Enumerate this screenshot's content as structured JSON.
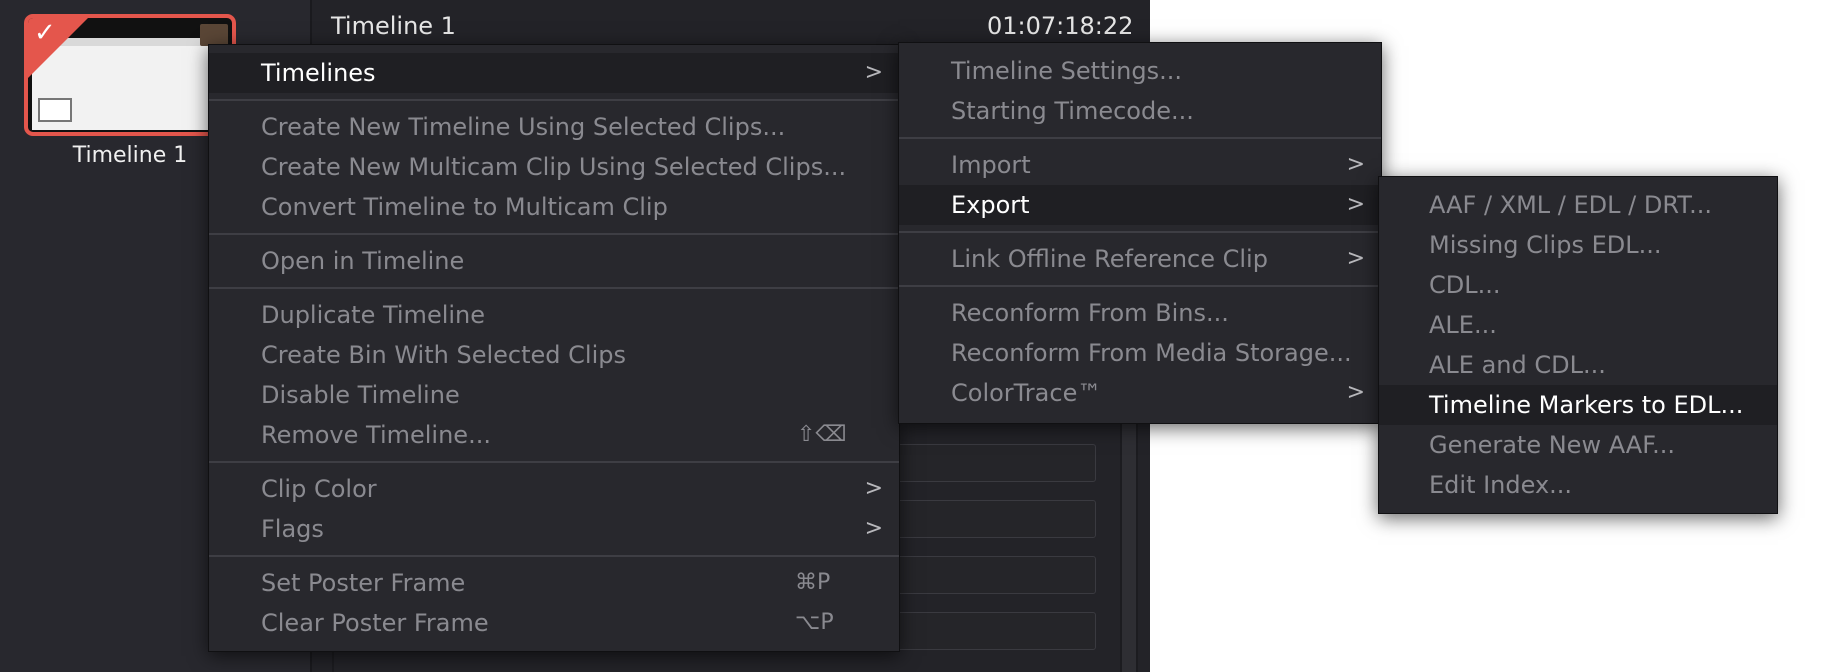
{
  "thumbnail": {
    "label": "Timeline 1",
    "selected": true
  },
  "inspector": {
    "title": "Timeline 1",
    "timecode": "01:07:18:22"
  },
  "context_menu": {
    "items": [
      {
        "label": "Timelines",
        "submenu": true,
        "highlighted": true
      },
      {
        "label": "Create New Timeline Using Selected Clips..."
      },
      {
        "label": "Create New Multicam Clip Using Selected Clips..."
      },
      {
        "label": "Convert Timeline to Multicam Clip"
      },
      {
        "label": "Open in Timeline"
      },
      {
        "label": "Duplicate Timeline"
      },
      {
        "label": "Create Bin With Selected Clips"
      },
      {
        "label": "Disable Timeline"
      },
      {
        "label": "Remove Timeline...",
        "shortcut": "⇧⌫"
      },
      {
        "label": "Clip Color",
        "submenu": true
      },
      {
        "label": "Flags",
        "submenu": true
      },
      {
        "label": "Set Poster Frame",
        "shortcut": "⌘P"
      },
      {
        "label": "Clear Poster Frame",
        "shortcut": "⌥P"
      }
    ]
  },
  "timelines_submenu": {
    "items": [
      {
        "label": "Timeline Settings..."
      },
      {
        "label": "Starting Timecode..."
      },
      {
        "label": "Import",
        "submenu": true
      },
      {
        "label": "Export",
        "submenu": true,
        "highlighted": true
      },
      {
        "label": "Link Offline Reference Clip",
        "submenu": true
      },
      {
        "label": "Reconform From Bins..."
      },
      {
        "label": "Reconform From Media Storage..."
      },
      {
        "label": "ColorTrace™",
        "submenu": true
      }
    ]
  },
  "export_submenu": {
    "items": [
      {
        "label": "AAF / XML / EDL / DRT..."
      },
      {
        "label": "Missing Clips EDL..."
      },
      {
        "label": "CDL..."
      },
      {
        "label": "ALE..."
      },
      {
        "label": "ALE and CDL..."
      },
      {
        "label": "Timeline Markers to EDL...",
        "highlighted": true
      },
      {
        "label": "Generate New AAF..."
      },
      {
        "label": "Edit Index..."
      }
    ]
  },
  "icons": {
    "submenu_arrow": "chevron-right-icon",
    "selected_check": "checkmark-icon"
  },
  "colors": {
    "accent": "#e4564c",
    "menu_bg": "#28282d",
    "highlight_bg": "#1f1f23"
  }
}
